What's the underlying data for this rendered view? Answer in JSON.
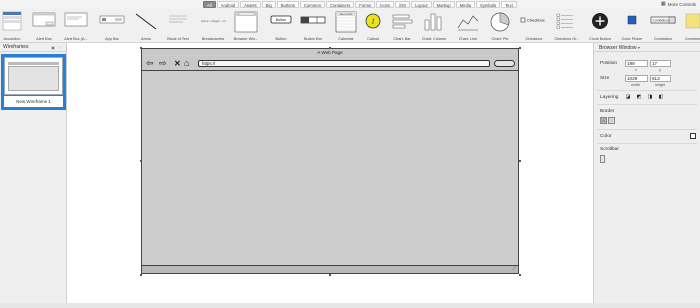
{
  "filter_tabs": [
    "All",
    "Android",
    "Assets",
    "Big",
    "Buttons",
    "Common",
    "Containers",
    "Forms",
    "Icons",
    "iOS",
    "Layout",
    "Markup",
    "Media",
    "Symbols",
    "Text"
  ],
  "active_filter": "All",
  "more_controls_label": "More Controls",
  "library_items": [
    {
      "label": "Accordion",
      "icon": "accordion-icon"
    },
    {
      "label": "Alert Box",
      "icon": "alert-box-icon"
    },
    {
      "label": "Alert Box (A...",
      "icon": "alert-box-android-icon"
    },
    {
      "label": "App Bar",
      "icon": "app-bar-icon"
    },
    {
      "label": "Arrow",
      "icon": "arrow-icon"
    },
    {
      "label": "Block of Text",
      "icon": "block-of-text-icon"
    },
    {
      "label": "Breadcrumbs",
      "icon": "breadcrumbs-icon"
    },
    {
      "label": "Browser Win...",
      "icon": "browser-window-icon"
    },
    {
      "label": "Button",
      "icon": "button-icon"
    },
    {
      "label": "Button Bar",
      "icon": "button-bar-icon"
    },
    {
      "label": "Calendar",
      "icon": "calendar-icon"
    },
    {
      "label": "Callout",
      "icon": "callout-icon"
    },
    {
      "label": "Chart: Bar",
      "icon": "chart-bar-icon"
    },
    {
      "label": "Chart: Column",
      "icon": "chart-column-icon"
    },
    {
      "label": "Chart: Line",
      "icon": "chart-line-icon"
    },
    {
      "label": "Chart: Pie",
      "icon": "chart-pie-icon"
    },
    {
      "label": "Checkbox",
      "icon": "checkbox-icon"
    },
    {
      "label": "Checkbox Gr...",
      "icon": "checkbox-group-icon"
    },
    {
      "label": "Circle Button",
      "icon": "circle-button-icon"
    },
    {
      "label": "Color Picker",
      "icon": "color-picker-icon"
    },
    {
      "label": "Combobox",
      "icon": "combobox-icon"
    },
    {
      "label": "Comment",
      "icon": "comment-icon"
    }
  ],
  "thumb_text": {
    "button": "Button",
    "checkbox": "Checkbox",
    "combobox": "Combobox",
    "breadcrumbs": "Home > Pages > Current",
    "calendar_month": "March 2019",
    "callout_number": "1"
  },
  "wireframes_panel": {
    "title": "Wireframes",
    "items": [
      {
        "name": "New Wireframe 1"
      }
    ]
  },
  "browser_window": {
    "title": "A Web Page",
    "url": "https://"
  },
  "inspector": {
    "title": "Browser Window",
    "position_label": "Position",
    "position_x": "199",
    "position_y": "17",
    "x_label": "x",
    "y_label": "y",
    "size_label": "Size",
    "width": "1029",
    "height": "613",
    "width_label": "width",
    "height_label": "height",
    "layering_label": "Layering",
    "border_label": "Border",
    "color_label": "Color",
    "scrollbar_label": "Scrollbar"
  },
  "colors": {
    "selection": "#2b7fd3",
    "active_tab": "#8a8a8a",
    "callout": "#e9e41c"
  }
}
